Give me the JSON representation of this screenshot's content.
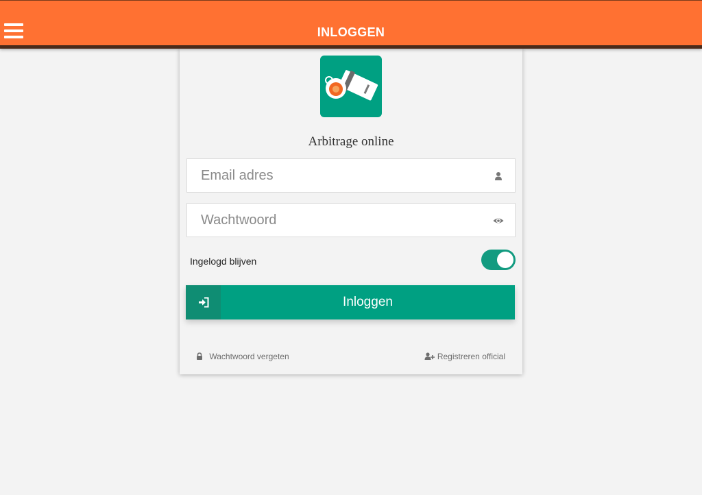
{
  "header": {
    "title": "INLOGGEN",
    "menu_icon": "hamburger-menu-icon",
    "background_color": "#ff7132"
  },
  "app": {
    "name": "Arbitrage online",
    "logo_icon": "whistle-icon",
    "logo_color": "#00a082"
  },
  "form": {
    "email": {
      "placeholder": "Email adres",
      "value": "",
      "icon": "user-icon"
    },
    "password": {
      "placeholder": "Wachtwoord",
      "value": "",
      "icon": "eye-icon"
    },
    "remember": {
      "label": "Ingelogd blijven",
      "enabled": true
    },
    "submit": {
      "label": "Inloggen",
      "icon": "sign-in-icon",
      "color": "#00a082"
    }
  },
  "links": {
    "forgot_password": "Wachtwoord vergeten",
    "register": "Registreren official"
  }
}
